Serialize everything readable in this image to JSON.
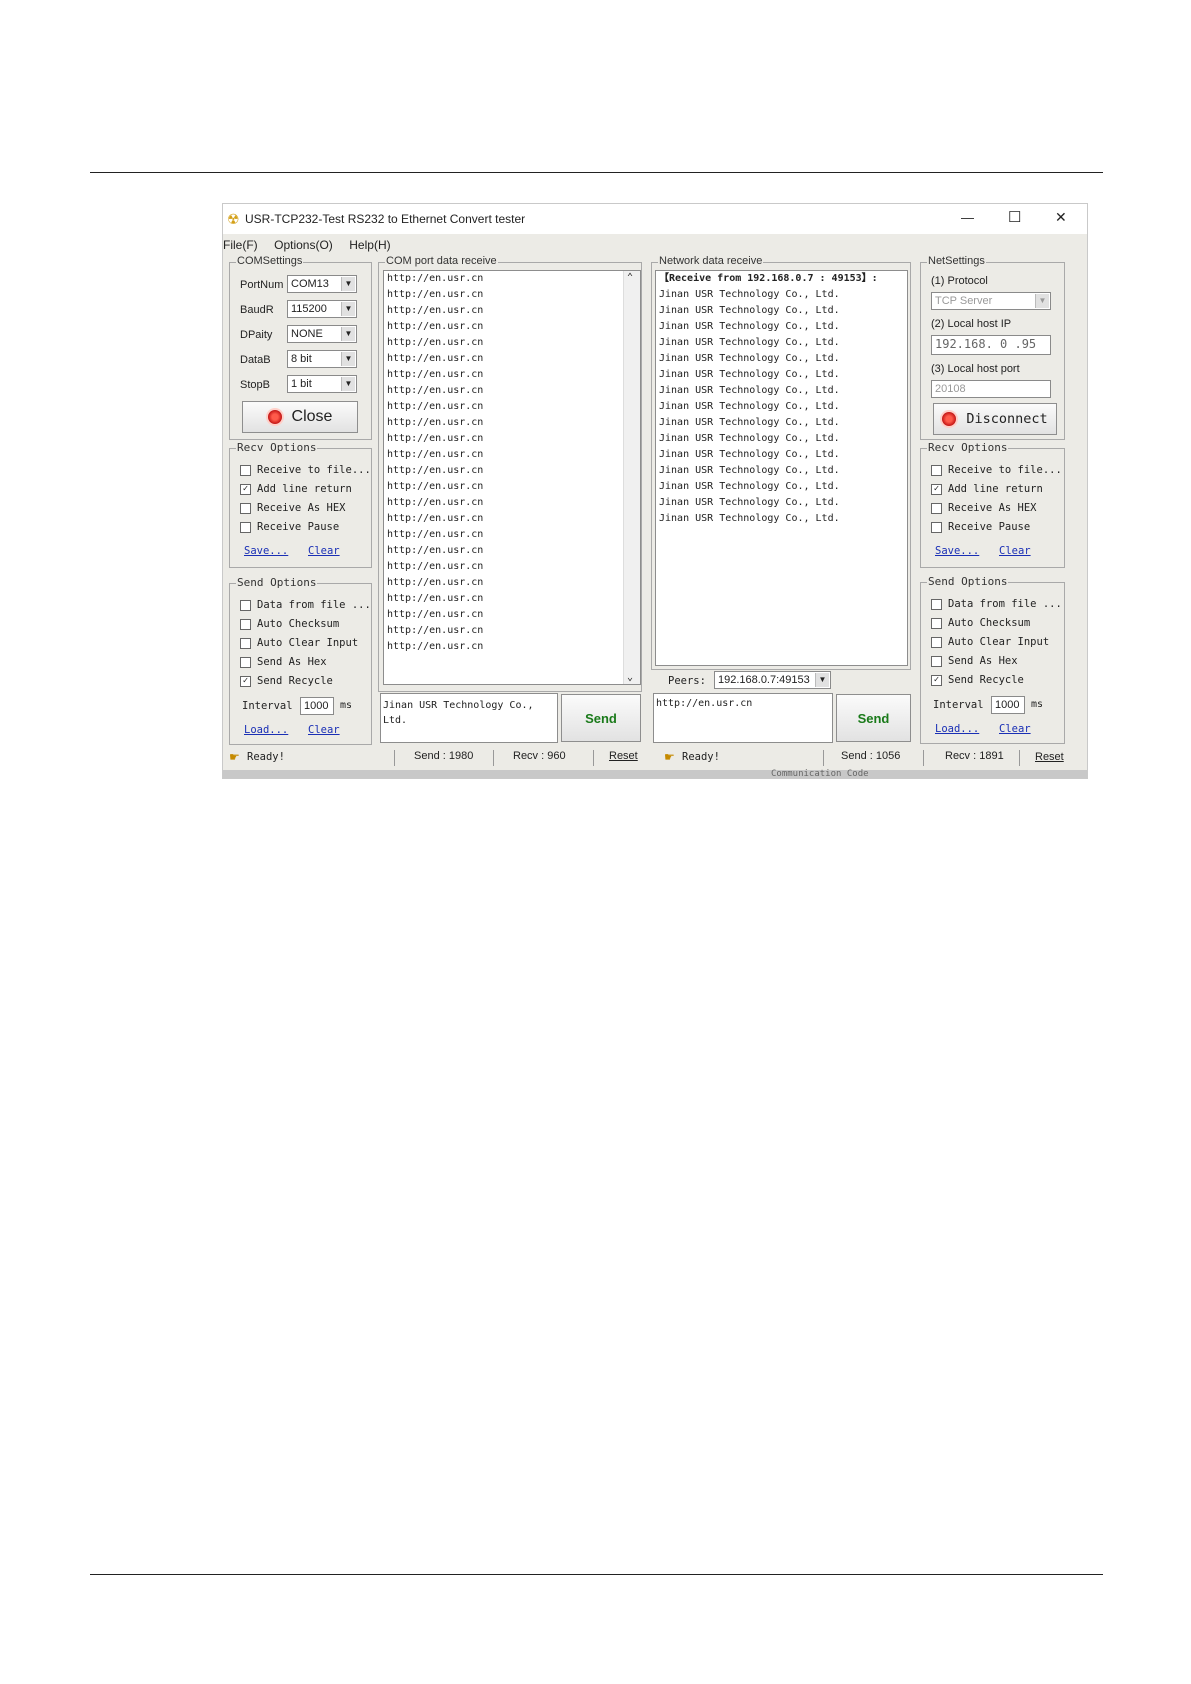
{
  "window": {
    "title": "USR-TCP232-Test  RS232 to Ethernet Convert tester",
    "controls": {
      "minimize": "—",
      "maximize": "☐",
      "close": "✕"
    }
  },
  "menu": [
    "File(F)",
    "Options(O)",
    "Help(H)"
  ],
  "com_settings": {
    "legend": "COMSettings",
    "portnum": {
      "label": "PortNum",
      "value": "COM13"
    },
    "baud": {
      "label": "BaudR",
      "value": "115200"
    },
    "parity": {
      "label": "DPaity",
      "value": "NONE"
    },
    "databits": {
      "label": "DataB",
      "value": "8 bit"
    },
    "stopbits": {
      "label": "StopB",
      "value": "1 bit"
    },
    "close_button": "Close"
  },
  "left_recv_options": {
    "legend": "Recv Options",
    "receive_to_file": "Receive to file...",
    "add_line_return": "Add line return",
    "receive_as_hex": "Receive As HEX",
    "receive_pause": "Receive Pause",
    "save": "Save...",
    "clear": "Clear",
    "checked": {
      "receive_to_file": false,
      "add_line_return": true,
      "receive_as_hex": false,
      "receive_pause": false
    }
  },
  "left_send_options": {
    "legend": "Send Options",
    "data_from_file": "Data from file ...",
    "auto_checksum": "Auto Checksum",
    "auto_clear_input": "Auto Clear Input",
    "send_as_hex": "Send As Hex",
    "send_recycle": "Send Recycle",
    "interval_label": "Interval",
    "interval_value": "1000",
    "interval_unit": "ms",
    "load": "Load...",
    "clear": "Clear",
    "checked": {
      "data_from_file": false,
      "auto_checksum": false,
      "auto_clear_input": false,
      "send_as_hex": false,
      "send_recycle": true
    }
  },
  "com_receive": {
    "legend": "COM port data receive",
    "lines": [
      "http://en.usr.cn",
      "http://en.usr.cn",
      "http://en.usr.cn",
      "http://en.usr.cn",
      "http://en.usr.cn",
      "http://en.usr.cn",
      "http://en.usr.cn",
      "http://en.usr.cn",
      "http://en.usr.cn",
      "http://en.usr.cn",
      "http://en.usr.cn",
      "http://en.usr.cn",
      "http://en.usr.cn",
      "http://en.usr.cn",
      "http://en.usr.cn",
      "http://en.usr.cn",
      "http://en.usr.cn",
      "http://en.usr.cn",
      "http://en.usr.cn",
      "http://en.usr.cn",
      "http://en.usr.cn",
      "http://en.usr.cn",
      "http://en.usr.cn",
      "http://en.usr.cn"
    ]
  },
  "com_send": {
    "text": "Jinan USR Technology Co., Ltd.",
    "button": "Send"
  },
  "network_receive": {
    "legend": "Network data receive",
    "header": "【Receive from 192.168.0.7 : 49153】:",
    "lines": [
      "Jinan USR Technology Co., Ltd.",
      "Jinan USR Technology Co., Ltd.",
      "Jinan USR Technology Co., Ltd.",
      "Jinan USR Technology Co., Ltd.",
      "Jinan USR Technology Co., Ltd.",
      "Jinan USR Technology Co., Ltd.",
      "Jinan USR Technology Co., Ltd.",
      "Jinan USR Technology Co., Ltd.",
      "Jinan USR Technology Co., Ltd.",
      "Jinan USR Technology Co., Ltd.",
      "Jinan USR Technology Co., Ltd.",
      "Jinan USR Technology Co., Ltd.",
      "Jinan USR Technology Co., Ltd.",
      "Jinan USR Technology Co., Ltd.",
      "Jinan USR Technology Co., Ltd."
    ],
    "peers_label": "Peers:",
    "peers_value": "192.168.0.7:49153"
  },
  "net_send": {
    "text": "http://en.usr.cn",
    "button": "Send"
  },
  "net_settings": {
    "legend": "NetSettings",
    "protocol_label": "(1) Protocol",
    "protocol_value": "TCP Server",
    "local_ip_label": "(2) Local host IP",
    "local_ip_value": "192.168. 0 .95",
    "local_port_label": "(3) Local host port",
    "local_port_value": "20108",
    "disconnect_button": "Disconnect"
  },
  "right_recv_options": {
    "legend": "Recv Options",
    "receive_to_file": "Receive to file...",
    "add_line_return": "Add line return",
    "receive_as_hex": "Receive As HEX",
    "receive_pause": "Receive Pause",
    "save": "Save...",
    "clear": "Clear",
    "checked": {
      "receive_to_file": false,
      "add_line_return": true,
      "receive_as_hex": false,
      "receive_pause": false
    }
  },
  "right_send_options": {
    "legend": "Send Options",
    "data_from_file": "Data from file ...",
    "auto_checksum": "Auto Checksum",
    "auto_clear_input": "Auto Clear Input",
    "send_as_hex": "Send As Hex",
    "send_recycle": "Send Recycle",
    "interval_label": "Interval",
    "interval_value": "1000",
    "interval_unit": "ms",
    "load": "Load...",
    "clear": "Clear",
    "checked": {
      "data_from_file": false,
      "auto_checksum": false,
      "auto_clear_input": false,
      "send_as_hex": false,
      "send_recycle": true
    }
  },
  "status_left": {
    "ready": "Ready!",
    "send": "Send : 1980",
    "recv": "Recv : 960",
    "reset": "Reset"
  },
  "status_right": {
    "ready": "Ready!",
    "send": "Send : 1056",
    "recv": "Recv : 1891",
    "reset": "Reset"
  },
  "behind_text": "Communication Code"
}
